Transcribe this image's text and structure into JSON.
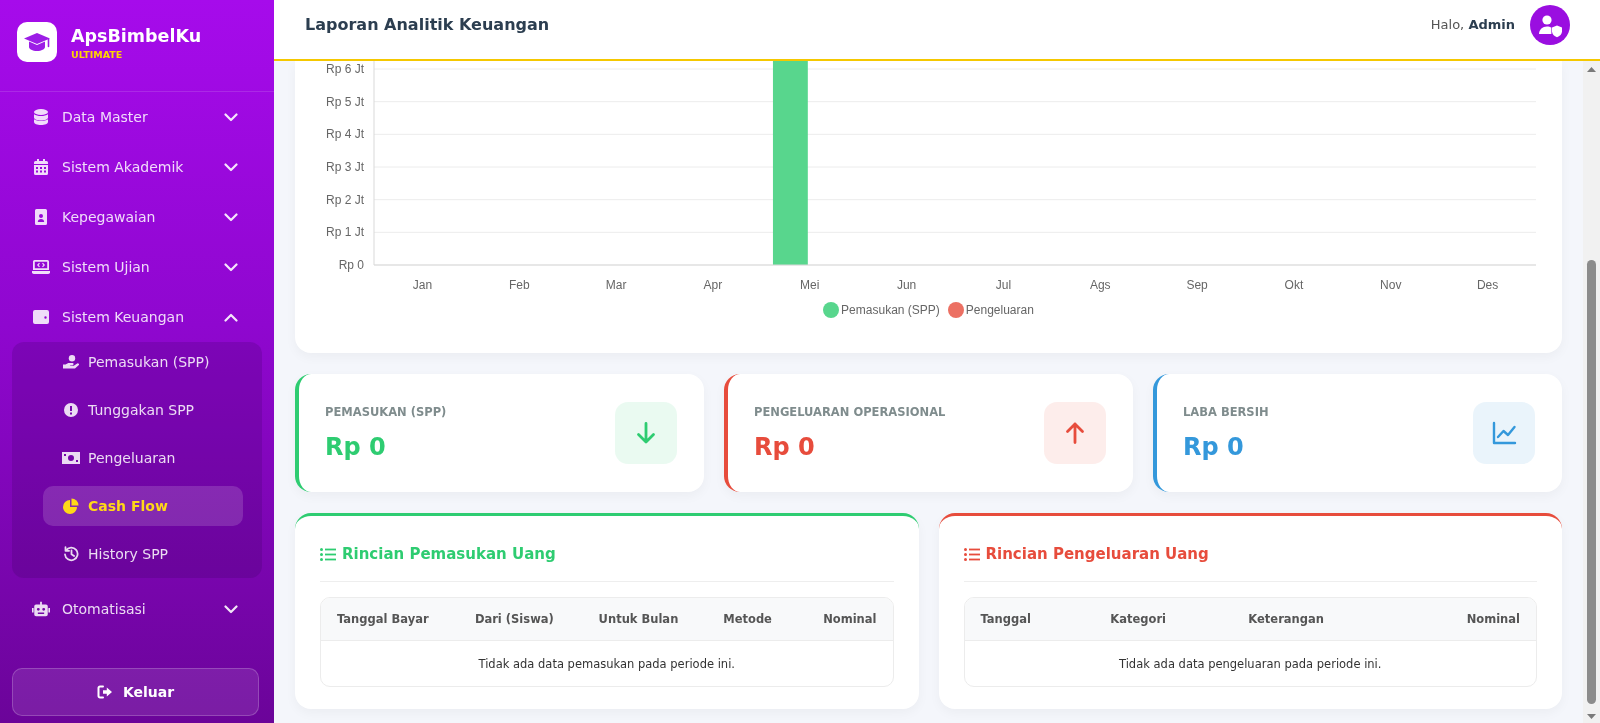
{
  "sidebar": {
    "brand": {
      "name": "ApsBimbelKu",
      "tier": "ULTIMATE"
    },
    "menu": [
      {
        "label": "Data Master",
        "expanded": false
      },
      {
        "label": "Sistem Akademik",
        "expanded": false
      },
      {
        "label": "Kepegawaian",
        "expanded": false
      },
      {
        "label": "Sistem Ujian",
        "expanded": false
      },
      {
        "label": "Sistem Keuangan",
        "expanded": true,
        "children": [
          {
            "label": "Pemasukan (SPP)",
            "selected": false
          },
          {
            "label": "Tunggakan SPP",
            "selected": false
          },
          {
            "label": "Pengeluaran",
            "selected": false
          },
          {
            "label": "Cash Flow",
            "selected": true
          },
          {
            "label": "History SPP",
            "selected": false
          }
        ]
      },
      {
        "label": "Otomatisasi",
        "expanded": false
      }
    ],
    "logout_button": "Keluar"
  },
  "header": {
    "title": "Laporan Analitik Keuangan",
    "greeting": "Halo, **Admin**"
  },
  "cash_flow_chart": {
    "y_axis_labels": [
      "Rp 6 Jt",
      "Rp 5 Jt",
      "Rp 4 Jt",
      "Rp 3 Jt",
      "Rp 2 Jt",
      "Rp 1 Jt",
      "Rp 0"
    ],
    "x_axis_labels": [
      "Jan",
      "Feb",
      "Mar",
      "Apr",
      "Mei",
      "Jun",
      "Jul",
      "Ags",
      "Sep",
      "Okt",
      "Nov",
      "Des"
    ],
    "legend": [
      {
        "label": "Pemasukan (SPP)",
        "color": "#58d68d"
      },
      {
        "label": "Pengeluaran",
        "color": "#ec7063"
      }
    ]
  },
  "stats": [
    {
      "label": "PEMASUKAN (SPP)",
      "value": "Rp 0",
      "color": "#2ecc71"
    },
    {
      "label": "PENGELUARAN OPERASIONAL",
      "value": "Rp 0",
      "color": "#e74c3c"
    },
    {
      "label": "LABA BERSIH",
      "value": "Rp 0",
      "color": "#3498db"
    }
  ],
  "details": [
    {
      "title": "Rincian Pemasukan Uang",
      "color": "#2ecc71",
      "columns": [
        "Tanggal Bayar",
        "Dari (Siswa)",
        "Untuk Bulan",
        "Metode",
        "Nominal"
      ],
      "empty_message": "Tidak ada data pemasukan pada periode ini."
    },
    {
      "title": "Rincian Pengeluaran Uang",
      "color": "#e74c3c",
      "columns": [
        "Tanggal",
        "Kategori",
        "Keterangan",
        "Nominal"
      ],
      "empty_message": "Tidak ada data pengeluaran pada periode ini."
    }
  ]
}
